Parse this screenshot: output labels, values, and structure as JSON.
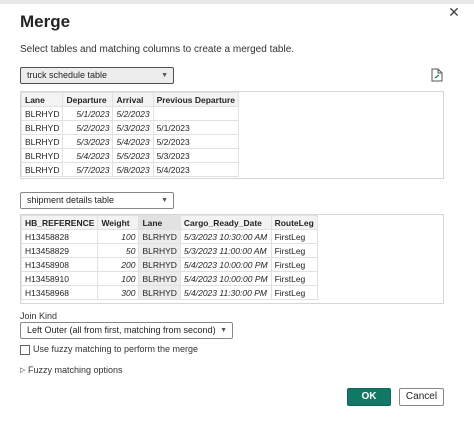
{
  "dialog": {
    "title": "Merge",
    "instruction": "Select tables and matching columns to create a merged table.",
    "close_glyph": "✕"
  },
  "first_table": {
    "selected": "truck schedule table",
    "columns": [
      "Lane",
      "Departure",
      "Arrival",
      "Previous Departure"
    ],
    "rows": [
      [
        "BLRHYD",
        "5/1/2023",
        "5/2/2023",
        ""
      ],
      [
        "BLRHYD",
        "5/2/2023",
        "5/3/2023",
        "5/1/2023"
      ],
      [
        "BLRHYD",
        "5/3/2023",
        "5/4/2023",
        "5/2/2023"
      ],
      [
        "BLRHYD",
        "5/4/2023",
        "5/5/2023",
        "5/3/2023"
      ],
      [
        "BLRHYD",
        "5/7/2023",
        "5/8/2023",
        "5/4/2023"
      ]
    ]
  },
  "second_table": {
    "selected": "shipment details table",
    "columns": [
      "HB_REFERENCE",
      "Weight",
      "Lane",
      "Cargo_Ready_Date",
      "RouteLeg"
    ],
    "rows": [
      [
        "H13458828",
        "100",
        "BLRHYD",
        "5/3/2023 10:30:00 AM",
        "FirstLeg"
      ],
      [
        "H13458829",
        "50",
        "BLRHYD",
        "5/3/2023 11:00:00 AM",
        "FirstLeg"
      ],
      [
        "H13458908",
        "200",
        "BLRHYD",
        "5/4/2023 10:00:00 PM",
        "FirstLeg"
      ],
      [
        "H13458910",
        "100",
        "BLRHYD",
        "5/4/2023 10:00:00 PM",
        "FirstLeg"
      ],
      [
        "H13458968",
        "300",
        "BLRHYD",
        "5/4/2023 11:30:00 PM",
        "FirstLeg"
      ]
    ]
  },
  "join": {
    "label": "Join Kind",
    "selected": "Left Outer (all from first, matching from second)",
    "fuzzy_checkbox_label": "Use fuzzy matching to perform the merge",
    "fuzzy_checked": false,
    "fuzzy_options_label": "Fuzzy matching options"
  },
  "buttons": {
    "ok": "OK",
    "cancel": "Cancel"
  },
  "colors": {
    "ok_bg": "#117865",
    "header_bg": "#f3f3f3"
  },
  "icons": [
    "close-icon",
    "file-icon",
    "chevron-down-icon",
    "expand-triangle-icon"
  ]
}
